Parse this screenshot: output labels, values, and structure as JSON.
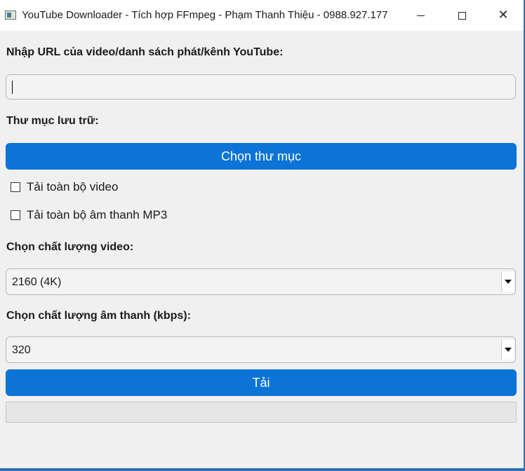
{
  "window": {
    "title": "YouTube Downloader - Tích hợp FFmpeg - Phạm Thanh Thiệu - 0988.927.177",
    "icon": "app-window-icon",
    "controls": {
      "minimize": "minimize-icon",
      "maximize": "maximize-icon",
      "close": "close-icon"
    }
  },
  "url": {
    "label": "Nhập URL của video/danh sách phát/kênh YouTube:",
    "value": "",
    "placeholder": ""
  },
  "folder": {
    "label": "Thư mục lưu trữ:",
    "button_label": "Chọn thư mục"
  },
  "options": {
    "download_all_video": {
      "label": "Tải toàn bộ video",
      "checked": false
    },
    "download_all_mp3": {
      "label": "Tải toàn bộ âm thanh MP3",
      "checked": false
    }
  },
  "video_quality": {
    "label": "Chọn chất lượng video:",
    "selected": "2160 (4K)"
  },
  "audio_quality": {
    "label": "Chọn chất lượng âm thanh (kbps):",
    "selected": "320"
  },
  "download": {
    "button_label": "Tải"
  },
  "progress": {
    "value": 0
  },
  "colors": {
    "accent": "#0b74d6",
    "window_border": "#2a6fb8",
    "background": "#f0f0f0"
  }
}
